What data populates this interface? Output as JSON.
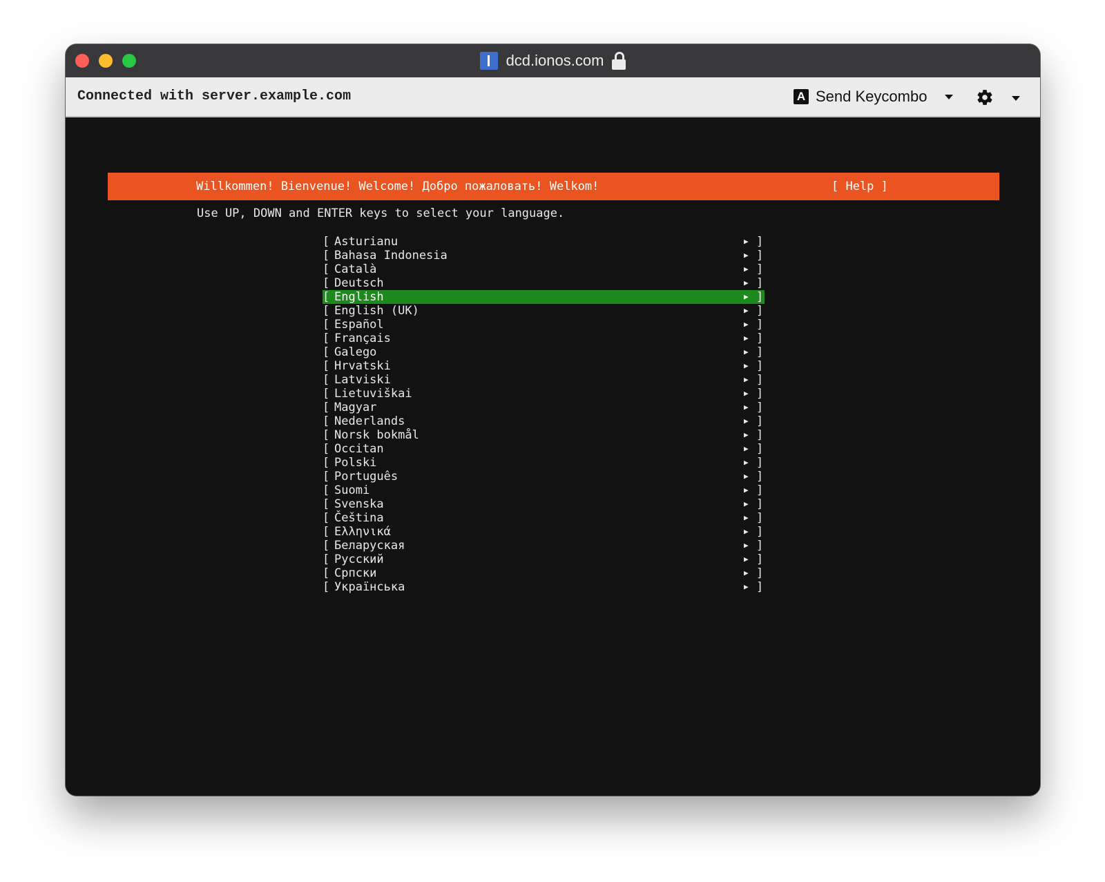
{
  "window": {
    "title": "dcd.ionos.com",
    "colors": {
      "close": "#fe5f57",
      "minimize": "#febc2e",
      "maximize": "#28c840",
      "site_icon": "#3e6fce"
    }
  },
  "toolbar": {
    "connection_status": "Connected with server.example.com",
    "keycombo_icon_letter": "A",
    "keycombo_label": "Send Keycombo",
    "settings_icon": "gear-icon"
  },
  "console": {
    "banner": {
      "text": "Willkommen! Bienvenue! Welcome! Добро пожаловать! Welkom!",
      "help": "[ Help ]",
      "color": "#e95420"
    },
    "instructions": "Use UP, DOWN and ENTER keys to select your language.",
    "selected_color": "#1e8a1e",
    "bracket_open": "[",
    "bracket_close": "]",
    "arrow": "▶",
    "languages": [
      {
        "label": "Asturianu",
        "selected": false
      },
      {
        "label": "Bahasa Indonesia",
        "selected": false
      },
      {
        "label": "Català",
        "selected": false
      },
      {
        "label": "Deutsch",
        "selected": false
      },
      {
        "label": "English",
        "selected": true
      },
      {
        "label": "English (UK)",
        "selected": false
      },
      {
        "label": "Español",
        "selected": false
      },
      {
        "label": "Français",
        "selected": false
      },
      {
        "label": "Galego",
        "selected": false
      },
      {
        "label": "Hrvatski",
        "selected": false
      },
      {
        "label": "Latviski",
        "selected": false
      },
      {
        "label": "Lietuviškai",
        "selected": false
      },
      {
        "label": "Magyar",
        "selected": false
      },
      {
        "label": "Nederlands",
        "selected": false
      },
      {
        "label": "Norsk bokmål",
        "selected": false
      },
      {
        "label": "Occitan",
        "selected": false
      },
      {
        "label": "Polski",
        "selected": false
      },
      {
        "label": "Português",
        "selected": false
      },
      {
        "label": "Suomi",
        "selected": false
      },
      {
        "label": "Svenska",
        "selected": false
      },
      {
        "label": "Čeština",
        "selected": false
      },
      {
        "label": "Ελληνικά",
        "selected": false
      },
      {
        "label": "Беларуская",
        "selected": false
      },
      {
        "label": "Русский",
        "selected": false
      },
      {
        "label": "Српски",
        "selected": false
      },
      {
        "label": "Українська",
        "selected": false
      }
    ]
  }
}
